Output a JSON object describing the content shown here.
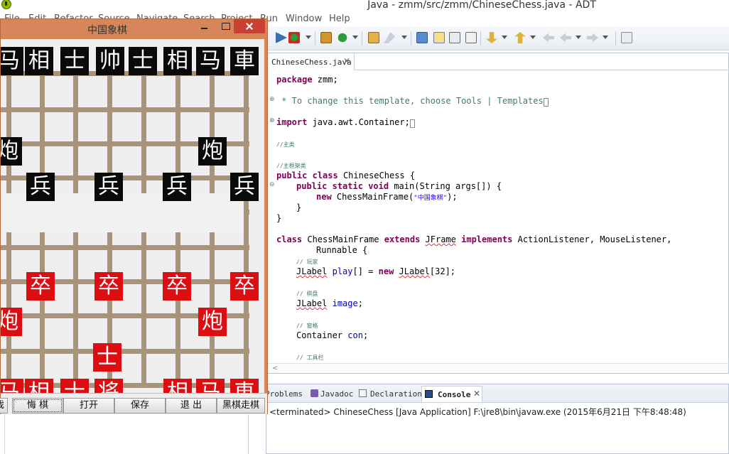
{
  "ide": {
    "window_title": "Java - zmm/src/zmm/ChineseChess.java - ADT",
    "menus": [
      "File",
      "Edit",
      "Refactor",
      "Source",
      "Navigate",
      "Search",
      "Project",
      "Run",
      "Window",
      "Help"
    ],
    "editor_tab": "ChineseChess.java",
    "code": {
      "l1_kw": "package",
      "l1_rest": " zmm;",
      "l2": " * To change this template, choose Tools | Templates",
      "l3_kw": "import",
      "l3_rest": " java.awt.Container;",
      "l4": "//主类",
      "l5": "//主框架类",
      "l6_kw1": "public",
      "l6_kw2": "class",
      "l6_rest": " ChineseChess {",
      "l7_kw1": "public",
      "l7_kw2": "static",
      "l7_kw3": "void",
      "l7_rest": " main(String args[]) {",
      "l8_kw": "new",
      "l8_rest1": " ChessMainFrame(",
      "l8_str": "\"中国象棋\"",
      "l8_rest2": ");",
      "l9": "}",
      "l10": "}",
      "l11_kw1": "class",
      "l11_mid1": " ChessMainFrame ",
      "l11_kw2": "extends",
      "l11_type": "JFrame",
      "l11_kw3": "implements",
      "l11_rest": " ActionListener, MouseListener,",
      "l12": "Runnable {",
      "l13": "// 玩家",
      "l14_type": "JLabel",
      "l14_field": "play",
      "l14_mid": "[] = ",
      "l14_kw": "new",
      "l14_type2": "JLabel",
      "l14_rest": "[32];",
      "l15": "// 棋盘",
      "l16_type": "JLabel",
      "l16_field": "image",
      "l16_rest": ";",
      "l17": "// 窗格",
      "l18_type": "Container",
      "l18_field": "con",
      "l18_rest": ";",
      "l19": "// 工具栏"
    },
    "bottom_tabs": {
      "problems": "Problems",
      "javadoc": "Javadoc",
      "declaration": "Declaration",
      "console": "Console"
    },
    "console_line": "<terminated> ChineseChess [Java Application] F:\\jre8\\bin\\javaw.exe (2015年6月21日 下午8:48:48)"
  },
  "chess": {
    "title": "中国象棋",
    "pieces": {
      "b_horse_l": "马",
      "b_elephant_l": "相",
      "b_advisor_l": "士",
      "b_general": "帅",
      "b_advisor_r": "士",
      "b_elephant_r": "相",
      "b_horse_r": "马",
      "b_chariot_r": "車",
      "b_cannon_l": "炮",
      "b_cannon_r": "炮",
      "b_soldier_1": "兵",
      "b_soldier_2": "兵",
      "b_soldier_3": "兵",
      "b_soldier_4": "兵",
      "r_soldier_1": "卒",
      "r_soldier_2": "卒",
      "r_soldier_3": "卒",
      "r_soldier_4": "卒",
      "r_cannon_l": "炮",
      "r_cannon_r": "炮",
      "r_advisor_mid": "士",
      "r_horse_l": "马",
      "r_elephant_l": "相",
      "r_advisor_l": "士",
      "r_general": "将",
      "r_elephant_r": "相",
      "r_horse_r": "马",
      "r_chariot_r": "車"
    },
    "buttons": {
      "new_game": "新游戏",
      "undo": "悔 棋",
      "open": "打开",
      "save": "保存",
      "exit": "退 出",
      "black_first": "黑棋走棋"
    }
  }
}
